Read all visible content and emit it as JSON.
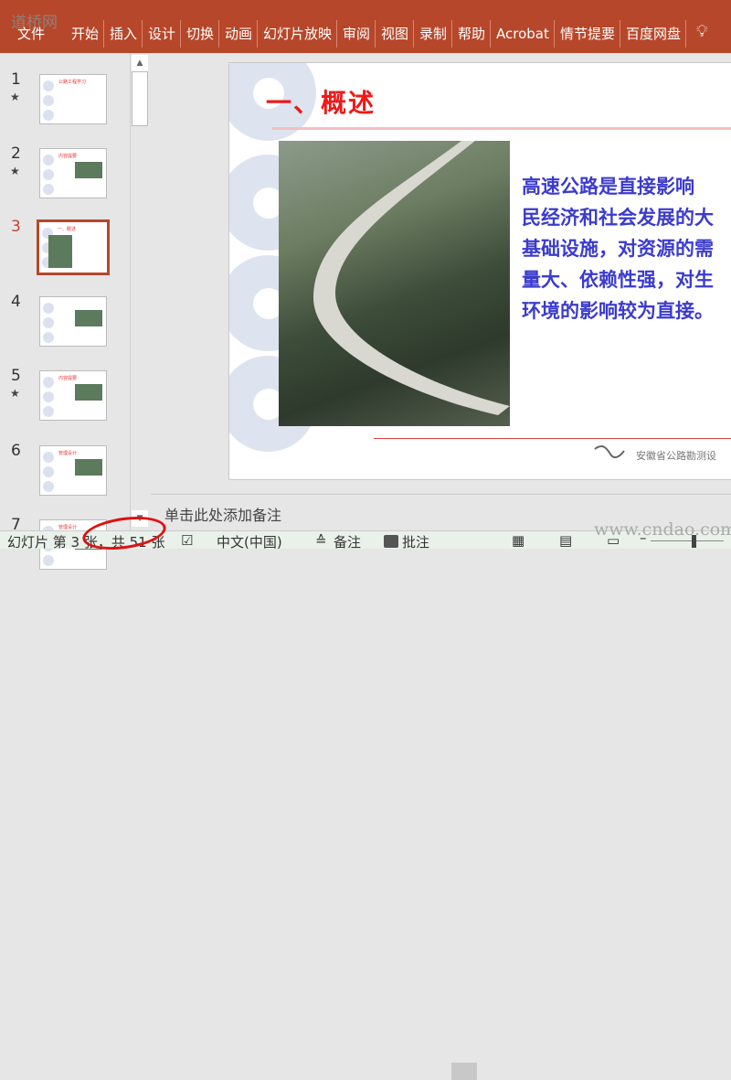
{
  "ribbon": {
    "logo": "道桥网",
    "tabs": [
      "文件",
      "开始",
      "插入",
      "设计",
      "切换",
      "动画",
      "幻灯片放映",
      "审阅",
      "视图",
      "录制",
      "帮助",
      "Acrobat",
      "情节提要",
      "百度网盘"
    ],
    "tell_me_icon": "lightbulb-icon"
  },
  "thumbnails": [
    {
      "num": "1",
      "star": "★",
      "title": "公路工程学习"
    },
    {
      "num": "2",
      "star": "★",
      "title": "内容提要"
    },
    {
      "num": "3",
      "star": "",
      "title": "一、概述"
    },
    {
      "num": "4",
      "star": "",
      "title": ""
    },
    {
      "num": "5",
      "star": "★",
      "title": "内容提要"
    },
    {
      "num": "6",
      "star": "",
      "title": "管理设计"
    },
    {
      "num": "7",
      "star": "",
      "title": "管理设计"
    }
  ],
  "slide": {
    "title": "一、概述",
    "body": [
      " 高速公路是直接影响",
      "民经济和社会发展的大",
      "基础设施，对资源的需",
      "量大、依赖性强，对生",
      "环境的影响较为直接。"
    ],
    "footer": "安徽省公路勘测设"
  },
  "notes": {
    "placeholder": "单击此处添加备注"
  },
  "status": {
    "slide_info": "幻灯片 第 3 张，共 51 张",
    "language": "中文(中国)",
    "notes": "备注",
    "comments": "批注"
  },
  "watermark": "www.cndao.com",
  "colors": {
    "accent": "#b7472a",
    "title": "#f01818",
    "body": "#3b3bcf"
  }
}
